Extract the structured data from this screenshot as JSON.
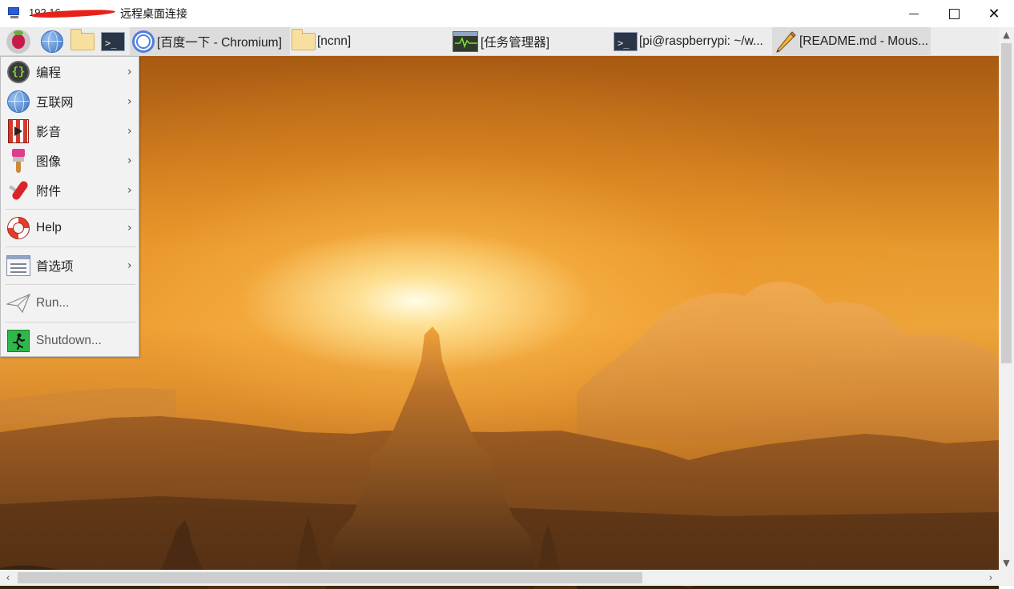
{
  "window": {
    "ip_prefix": "192.16",
    "title": "远程桌面连接",
    "controls": {
      "minimize": "minimize",
      "maximize": "maximize",
      "close": "close"
    }
  },
  "taskbar": {
    "launchers": [
      {
        "icon": "raspberry-pi-icon"
      },
      {
        "icon": "globe-icon"
      },
      {
        "icon": "folder-icon"
      },
      {
        "icon": "terminal-icon"
      }
    ],
    "tasks": [
      {
        "label": "[百度一下 - Chromium]",
        "icon": "chromium-icon"
      },
      {
        "label": "[ncnn]",
        "icon": "folder-icon"
      },
      {
        "label": "[任务管理器]",
        "icon": "task-manager-icon"
      },
      {
        "label": "[pi@raspberrypi: ~/w...",
        "icon": "terminal-icon"
      },
      {
        "label": "[README.md - Mous...",
        "icon": "pencil-icon"
      }
    ]
  },
  "menu": {
    "items": [
      {
        "label": "编程",
        "icon": "programming-icon",
        "submenu": true
      },
      {
        "label": "互联网",
        "icon": "globe-icon",
        "submenu": true
      },
      {
        "label": "影音",
        "icon": "sound-video-icon",
        "submenu": true
      },
      {
        "label": "图像",
        "icon": "paintbrush-icon",
        "submenu": true
      },
      {
        "label": "附件",
        "icon": "accessories-icon",
        "submenu": true
      },
      {
        "label": "Help",
        "icon": "help-lifebuoy-icon",
        "submenu": true
      },
      {
        "label": "首选项",
        "icon": "preferences-icon",
        "submenu": true
      },
      {
        "label": "Run...",
        "icon": "run-paper-plane-icon",
        "submenu": false
      },
      {
        "label": "Shutdown...",
        "icon": "shutdown-icon",
        "submenu": false
      }
    ],
    "submenu_arrow": "›"
  },
  "scrollbars": {
    "vertical_position": 0.0,
    "horizontal_position": 0.0,
    "up_arrow": "▲",
    "down_arrow": "▼",
    "left_arrow": "‹",
    "right_arrow": "›"
  },
  "colors": {
    "titlebar_bg": "#ffffff",
    "taskbar_bg": "#ececec",
    "menu_bg": "#f2f2f2",
    "sky_sun": "#fff4c8",
    "sky_mid": "#eea43a",
    "sky_dark": "#a85a12",
    "silhouette": "#4a2a12"
  }
}
